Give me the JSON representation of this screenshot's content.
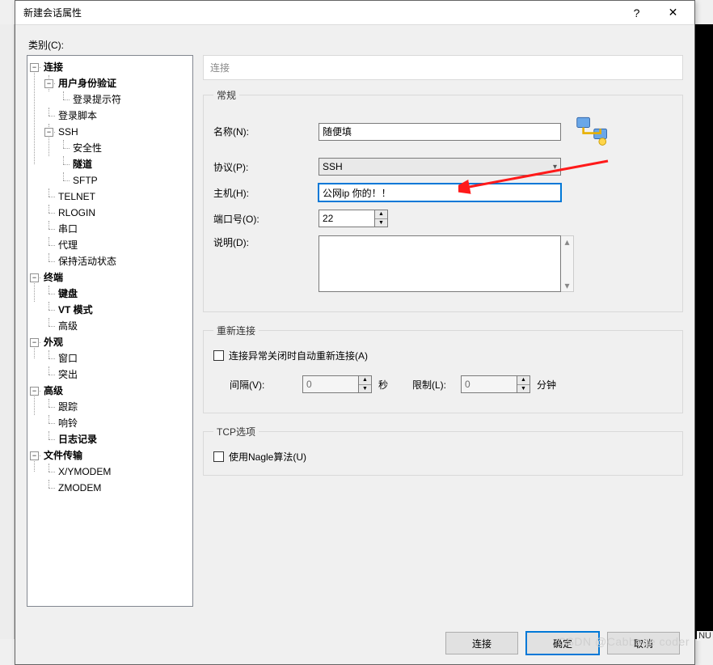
{
  "window": {
    "title": "新建会话属性"
  },
  "category_label": "类别(C):",
  "tree": {
    "connection": "连接",
    "auth": "用户身份验证",
    "login_prompt": "登录提示符",
    "login_script": "登录脚本",
    "ssh": "SSH",
    "security": "安全性",
    "tunnel": "隧道",
    "sftp": "SFTP",
    "telnet": "TELNET",
    "rlogin": "RLOGIN",
    "serial": "串口",
    "proxy": "代理",
    "keepalive": "保持活动状态",
    "terminal": "终端",
    "keyboard": "键盘",
    "vtmode": "VT 模式",
    "advanced_term": "高级",
    "appearance": "外观",
    "window": "窗口",
    "highlight": "突出",
    "advanced": "高级",
    "trace": "跟踪",
    "bell": "响铃",
    "logging": "日志记录",
    "filetransfer": "文件传输",
    "xymodem": "X/YMODEM",
    "zmodem": "ZMODEM"
  },
  "panel": {
    "header": "连接",
    "general_legend": "常规",
    "name_label": "名称(N):",
    "name_value": "随便填",
    "protocol_label": "协议(P):",
    "protocol_value": "SSH",
    "host_label": "主机(H):",
    "host_value": "公网ip 你的！！",
    "port_label": "端口号(O):",
    "port_value": "22",
    "desc_label": "说明(D):",
    "desc_value": "",
    "reconnect_legend": "重新连接",
    "reconnect_chk": "连接异常关闭时自动重新连接(A)",
    "interval_label": "间隔(V):",
    "interval_value": "0",
    "seconds": "秒",
    "limit_label": "限制(L):",
    "limit_value": "0",
    "minutes": "分钟",
    "tcp_legend": "TCP选项",
    "nagle_chk": "使用Nagle算法(U)"
  },
  "buttons": {
    "connect": "连接",
    "ok": "确定",
    "cancel": "取消"
  },
  "watermark": "CSDN @Cabbage coder",
  "corner": "NU"
}
